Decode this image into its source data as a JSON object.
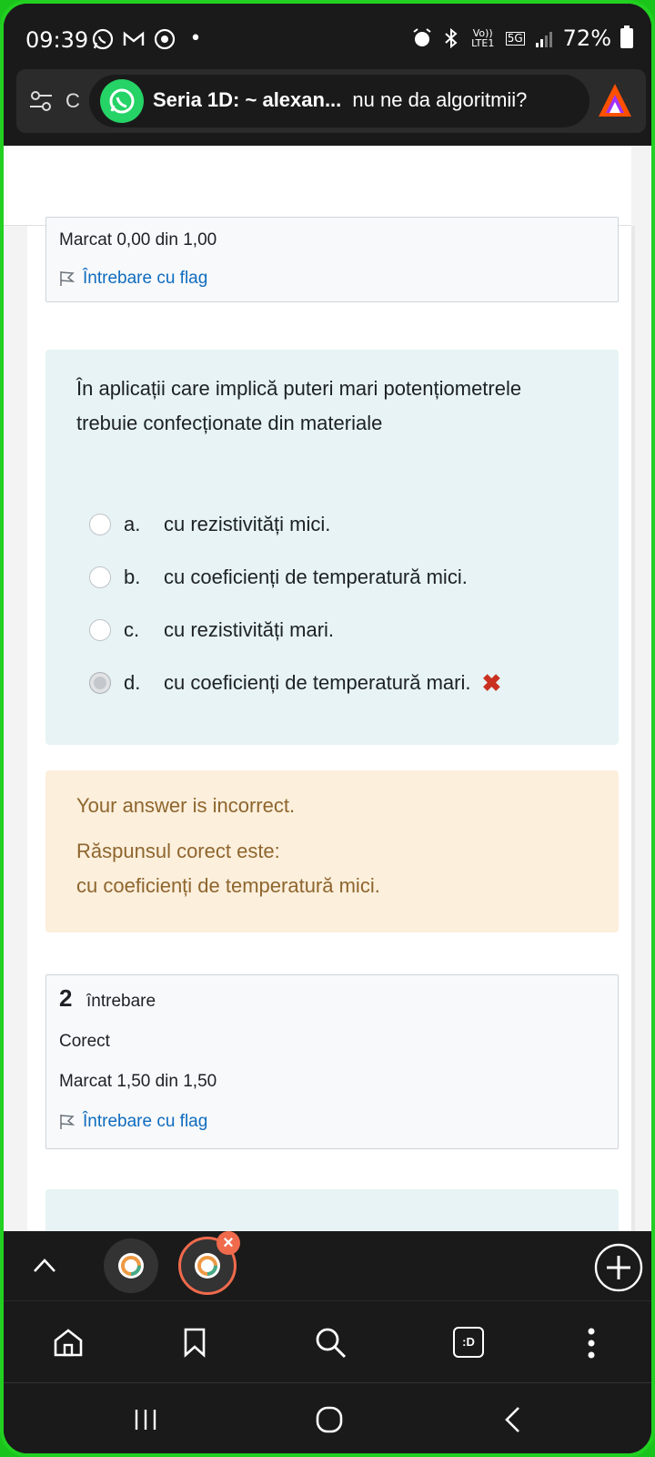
{
  "status_bar": {
    "time": "09:39",
    "volte_label": "Vo)) LTE1",
    "network": "5G",
    "battery": "72%"
  },
  "url_bar": {
    "prefix": "C",
    "title_bold": "Seria 1D: ~ alexan...",
    "title_rest": "nu ne da algoritmii?"
  },
  "top_info": {
    "marks": "Marcat 0,00 din 1,00",
    "flag": "Întrebare cu flag"
  },
  "question": {
    "text": "În aplicații care implică puteri mari potențiometrele trebuie confecționate din materiale",
    "answers": [
      {
        "letter": "a.",
        "text": "cu rezistivități mici.",
        "selected": false
      },
      {
        "letter": "b.",
        "text": "cu coeficienți de temperatură mici.",
        "selected": false
      },
      {
        "letter": "c.",
        "text": "cu rezistivități mari.",
        "selected": false
      },
      {
        "letter": "d.",
        "text": "cu coeficienți de temperatură mari.",
        "selected": true
      }
    ],
    "wrong_mark": "✖"
  },
  "feedback": {
    "status": "Your answer is incorrect.",
    "correct_label": "Răspunsul corect este:",
    "correct_answer": "cu coeficienți de temperatură mici."
  },
  "question2": {
    "number": "2",
    "label": "întrebare",
    "state": "Corect",
    "marks": "Marcat 1,50 din 1,50",
    "flag": "Întrebare cu flag"
  },
  "nav": {
    "tab_counter": ":D"
  },
  "colors": {
    "flag_link": "#0f6cbf",
    "wrong": "#ca3120",
    "feedback_text": "#8e662e",
    "question_bg": "#e7f3f5",
    "feedback_bg": "#fcefdc"
  }
}
